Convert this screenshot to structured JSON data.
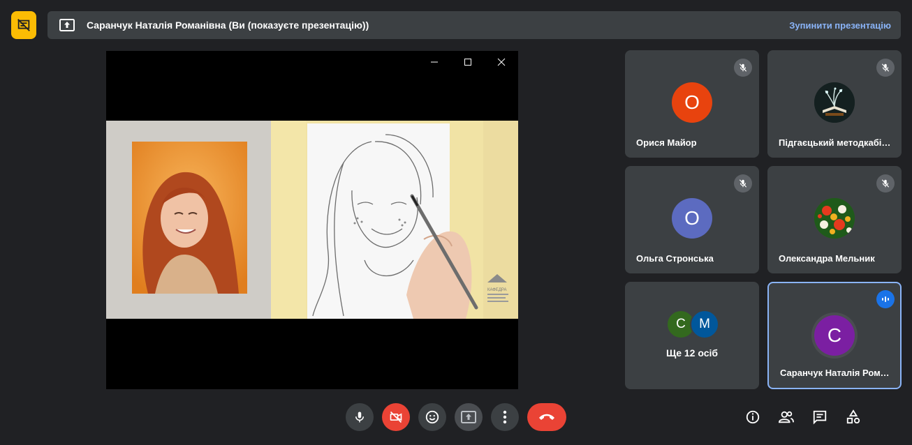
{
  "presentation": {
    "title": "Саранчук Наталія Романівна (Ви (показуєте презентацію))",
    "stop_label": "Зупинити презентацію"
  },
  "slide": {
    "logo_text": "КАФЕДРА"
  },
  "tiles": [
    {
      "name": "Орися Майор",
      "initial": "О",
      "color": "#e8430e",
      "muted": true
    },
    {
      "name": "Підгаєцький методкабінет",
      "initial": "",
      "muted": true
    },
    {
      "name": "Ольга Стронська",
      "initial": "О",
      "color": "#5c6bc0",
      "muted": true
    },
    {
      "name": "Олександра Мельник",
      "initial": "",
      "muted": true
    },
    {
      "more_label": "Ще 12 осіб",
      "avatars": [
        {
          "initial": "С",
          "color": "#33691e"
        },
        {
          "initial": "М",
          "color": "#01579b"
        }
      ]
    },
    {
      "name": "Саранчук Наталія Романівна",
      "initial": "С",
      "color": "#7b1fa2",
      "speaking": true
    }
  ],
  "controls": {
    "icons": [
      "mic-icon",
      "camera-off-icon",
      "emoji-icon",
      "present-icon",
      "more-vert-icon",
      "call-end-icon"
    ],
    "right_icons": [
      "info-icon",
      "people-icon",
      "chat-icon",
      "activities-icon"
    ]
  },
  "colors": {
    "background": "#202124",
    "tile": "#3c4043",
    "accent": "#8ab4f8",
    "danger": "#ea4335",
    "badge": "#fbbc04"
  }
}
